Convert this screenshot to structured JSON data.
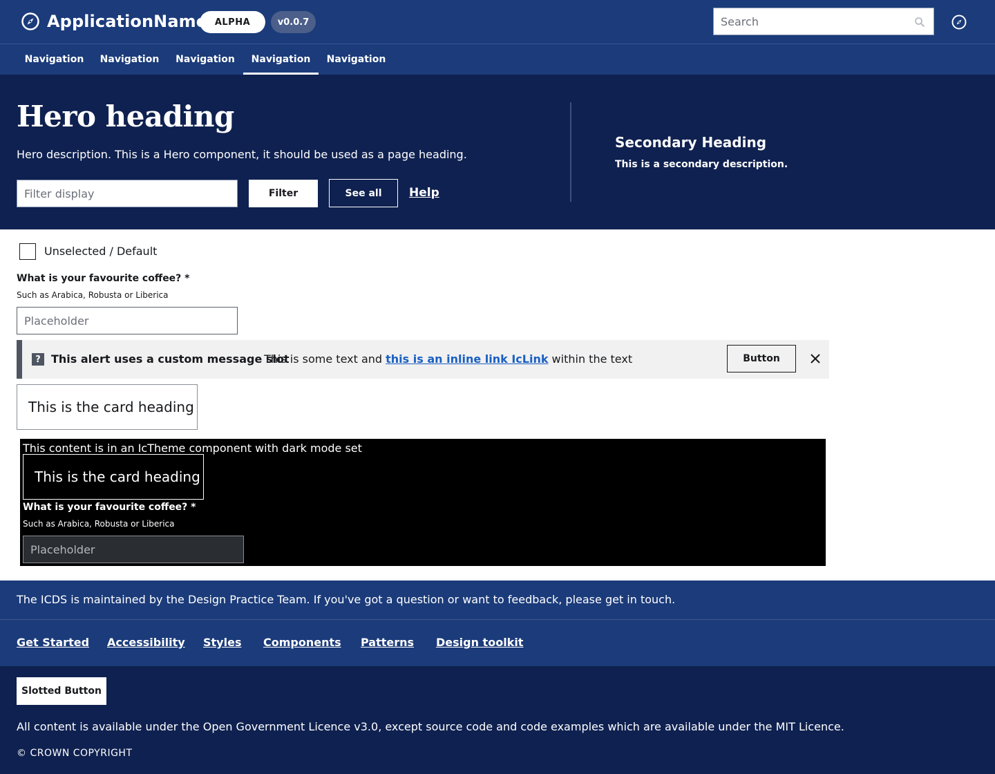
{
  "header": {
    "app_name": "ApplicationName",
    "status_badge": "ALPHA",
    "version_badge": "v0.0.7",
    "search_placeholder": "Search",
    "nav": [
      {
        "label": "Navigation",
        "active": false
      },
      {
        "label": "Navigation",
        "active": false
      },
      {
        "label": "Navigation",
        "active": false
      },
      {
        "label": "Navigation",
        "active": true
      },
      {
        "label": "Navigation",
        "active": false
      }
    ]
  },
  "hero": {
    "heading": "Hero heading",
    "description": "Hero description. This is a Hero component, it should be used as a page heading.",
    "filter_placeholder": "Filter display",
    "filter_button": "Filter",
    "see_all_button": "See all",
    "help_link": "Help",
    "secondary_heading": "Secondary Heading",
    "secondary_description": "This is a secondary description."
  },
  "main": {
    "checkbox_label": "Unselected / Default",
    "coffee_label": "What is your favourite coffee? *",
    "coffee_hint": "Such as Arabica, Robusta or Liberica",
    "coffee_placeholder": "Placeholder",
    "alert": {
      "title": "This alert uses a custom message slot",
      "text_before": "This is some text and ",
      "link": "this is an inline link IcLink",
      "text_after": " within the text",
      "button": "Button"
    },
    "card_heading": "This is the card heading",
    "dark": {
      "note": "This content is in an IcTheme component with dark mode set",
      "card_heading": "This is the card heading",
      "coffee_label": "What is your favourite coffee? *",
      "coffee_hint": "Such as Arabica, Robusta or Liberica",
      "coffee_placeholder": "Placeholder"
    }
  },
  "footer": {
    "description": "The ICDS is maintained by the Design Practice Team. If you've got a question or want to feedback, please get in touch.",
    "links": [
      "Get Started",
      "Accessibility",
      "Styles",
      "Components",
      "Patterns",
      "Design toolkit"
    ],
    "slotted_button": "Slotted Button",
    "licence": "All content is available under the Open Government Licence v3.0, except source code and code examples which are available under the MIT Licence.",
    "copyright": "© CROWN COPYRIGHT"
  },
  "colors": {
    "header_bg": "#1b3b7a",
    "hero_bg": "#0f2150",
    "link_blue": "#1a5fc2",
    "alert_bg": "#f1f1f1"
  },
  "icons": {
    "brand": "compass-icon",
    "search": "search-icon",
    "alert": "question-icon",
    "dismiss": "close-icon"
  }
}
